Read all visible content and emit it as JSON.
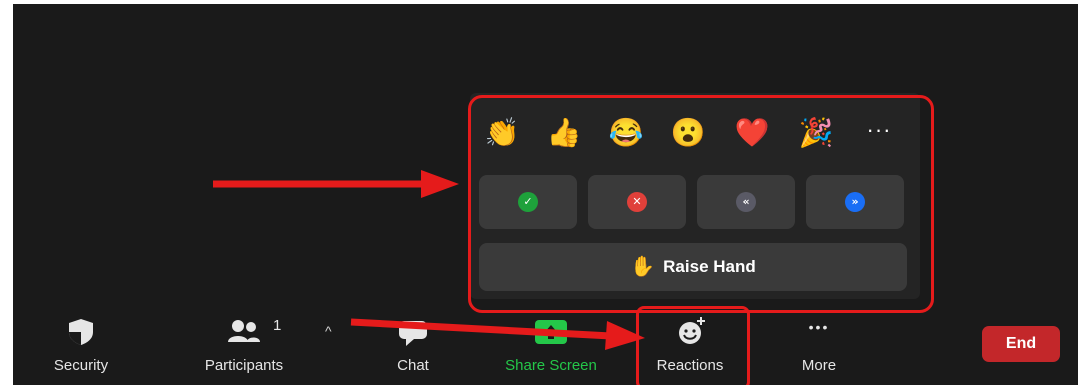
{
  "popup": {
    "emojis": [
      {
        "name": "clap-emoji",
        "glyph": "👏"
      },
      {
        "name": "thumbs-up-emoji",
        "glyph": "👍"
      },
      {
        "name": "joy-emoji",
        "glyph": "😂"
      },
      {
        "name": "open-mouth-emoji",
        "glyph": "😮"
      },
      {
        "name": "heart-emoji",
        "glyph": "❤️"
      },
      {
        "name": "party-popper-emoji",
        "glyph": "🎉"
      }
    ],
    "more_label": "···",
    "nonverbal": [
      {
        "name": "yes-button",
        "icon": "check-icon",
        "glyph": "✓",
        "color": "#1ea13b"
      },
      {
        "name": "no-button",
        "icon": "x-icon",
        "glyph": "✕",
        "color": "#e0403a"
      },
      {
        "name": "slow-down-button",
        "icon": "rewind-icon",
        "glyph": "«",
        "color": "#5a5a66"
      },
      {
        "name": "speed-up-button",
        "icon": "fast-forward-icon",
        "glyph": "»",
        "color": "#1a6ef5"
      }
    ],
    "raise_hand": {
      "glyph": "✋",
      "label": "Raise Hand"
    }
  },
  "toolbar": {
    "security_label": "Security",
    "participants_label": "Participants",
    "participants_count": "1",
    "caret": "^",
    "chat_label": "Chat",
    "share_label": "Share Screen",
    "reactions_label": "Reactions",
    "more_label": "More",
    "more_dots": "•••",
    "end_label": "End"
  },
  "colors": {
    "background": "#1a1a1a",
    "popup": "#242424",
    "button": "#3a3a3a",
    "share_green": "#24c749",
    "end_red": "#c3272a",
    "annotation_red": "#e51b1b"
  }
}
